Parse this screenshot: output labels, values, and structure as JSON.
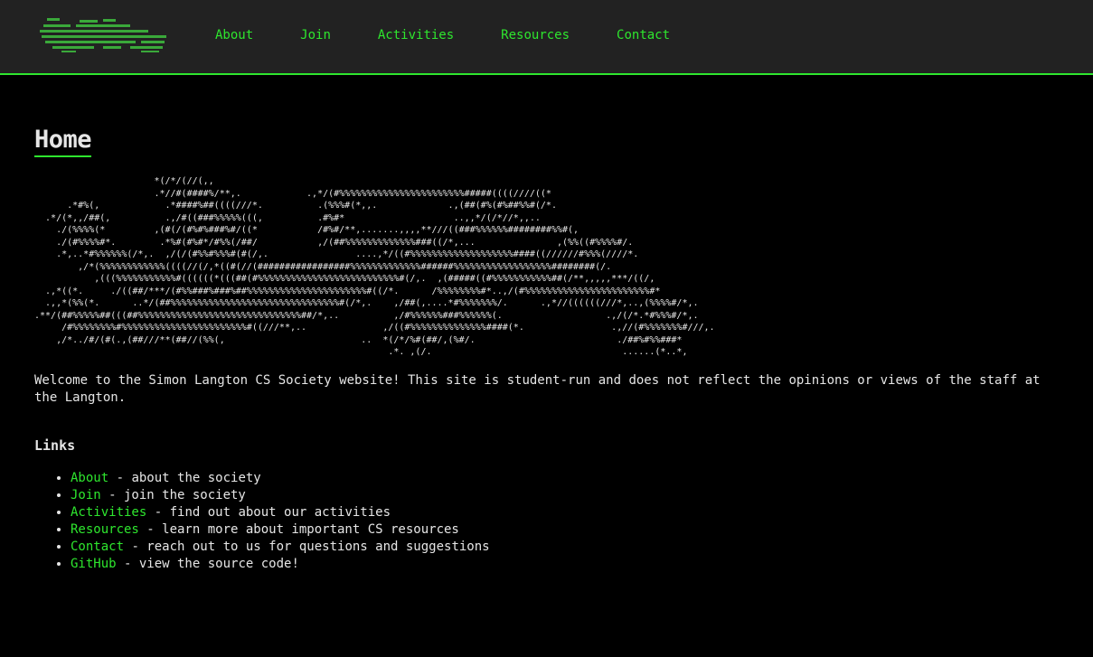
{
  "nav": {
    "logo_icon": "ascii-art-logo",
    "items": [
      {
        "label": "About"
      },
      {
        "label": "Join"
      },
      {
        "label": "Activities"
      },
      {
        "label": "Resources"
      },
      {
        "label": "Contact"
      }
    ]
  },
  "page": {
    "title": "Home",
    "ascii_art": "                      *(/*/(//(,,\n                      .*//#(####%/**,.            .,*/(#%%%%%%%%%%%%%%%%%%%%%%%#####((((////((*\n      .*#%(,            .*####%##((((///*.          .(%%%#(*,,.             .,(##(#%(#%##%%#(/*.\n  .*/(*,,/##(,          .,/#((###%%%%%(((,          .#%#*                    ..,,*/(/*//*,,..\n    ./(%%%%(*         ,(#(/(#%#%###%#/((*           /#%#/**,.......,,,,**///((###%%%%%%########%%#(,\n    ./(#%%%%#*.        .*%#(#%#*/#%%(/##/           ,/(##%%%%%%%%%%%%%###((/*,...               ,(%%((#%%%%#/.\n    .*,..*#%%%%%%(/*,.  ,/(/(#%%#%%%#(#(/,.                ....,*/((#%%%%%%%%%%%%%%%%%%%####((//////#%%%(////*.\n        ,/*(%%%%%%%%%%%%((((//(/,*((#(//(#################%%%%%%%%%%%%%######%%%%%%%%%%%%%%%%%%########(/.\n           ,(((%%%%%%%%%%%#((((((*(((##(#%%%%%%%%%%%%%%%%%%%%%%%%%%#(/,.  ,(#####((#%%%%%%%%%%%##(/**,,,,,***/((/,\n  .,*((*.     ./((##/***/(#%%###%###%##%%%%%%%%%%%%%%%%%%%%%%#((/*.      /%%%%%%%%#*..,/(#%%%%%%%%%%%%%%%%%%%%%%%#*\n  .,,*(%%(*.      ..*/(##%%%%%%%%%%%%%%%%%%%%%%%%%%%%%%%#(/*,.    ,/##(,....*#%%%%%%%/.      .,*//((((((///*,..,(%%%%#/*,.\n.**/(##%%%%%##(((##%%%%%%%%%%%%%%%%%%%%%%%%%%%%%%##/*,..          ,/#%%%%%%###%%%%%%(.                   .,/(/*.*#%%%#/*,.\n     /#%%%%%%%%#%%%%%%%%%%%%%%%%%%%%%%%#((///**,..              ,/((#%%%%%%%%%%%%%%####(*.                .,//(#%%%%%%%#///,.\n    ,/*../#/(#(.,(##///**(##//(%%(,                         ..  *(/*/%#(##/,(%#/.                          ./##%#%%###*\n                                                                 .*. ,(/.                                   ......(*..*,",
    "welcome": "Welcome to the Simon Langton CS Society website! This site is student-run and does not reflect the opinions or views of the staff at the Langton.",
    "links_heading": "Links",
    "links": [
      {
        "label": "About",
        "desc": " - about the society"
      },
      {
        "label": "Join",
        "desc": " - join the society"
      },
      {
        "label": "Activities",
        "desc": " - find out about our activities"
      },
      {
        "label": "Resources",
        "desc": " - learn more about important CS resources"
      },
      {
        "label": "Contact",
        "desc": " - reach out to us for questions and suggestions"
      },
      {
        "label": "GitHub",
        "desc": " - view the source code!"
      }
    ]
  },
  "colors": {
    "accent": "#2ee62e",
    "header_bg": "#222222",
    "page_bg": "#000000",
    "text": "#e6e6e6"
  }
}
